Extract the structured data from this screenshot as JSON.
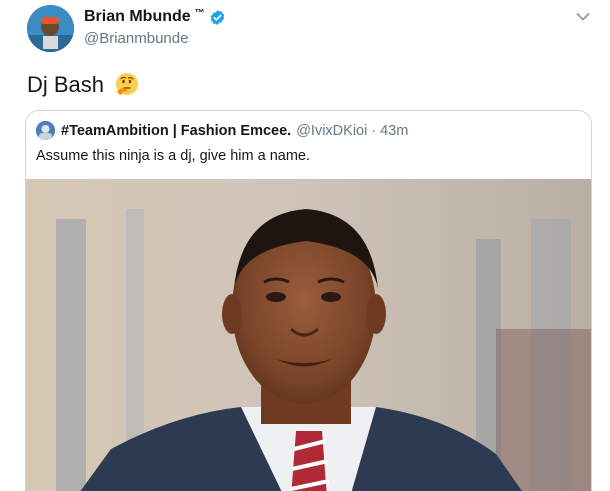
{
  "tweet": {
    "author_name": "Brian Mbunde",
    "trademark": "™",
    "handle": "@Brianmbunde",
    "text": "Dj Bash",
    "emoji": "thinking-face",
    "verified": true
  },
  "quoted_tweet": {
    "author_name": "#TeamAmbition | Fashion Emcee.",
    "handle": "@IvixDKioi",
    "separator": "·",
    "time": "43m",
    "text": "Assume this ninja is a dj, give him a name."
  },
  "icons": [
    "verified-badge-icon",
    "chevron-down-icon",
    "thinking-face-emoji"
  ],
  "colors": {
    "verified": "#1da1f2",
    "secondary_text": "#657786",
    "border": "#ccd6dd"
  }
}
